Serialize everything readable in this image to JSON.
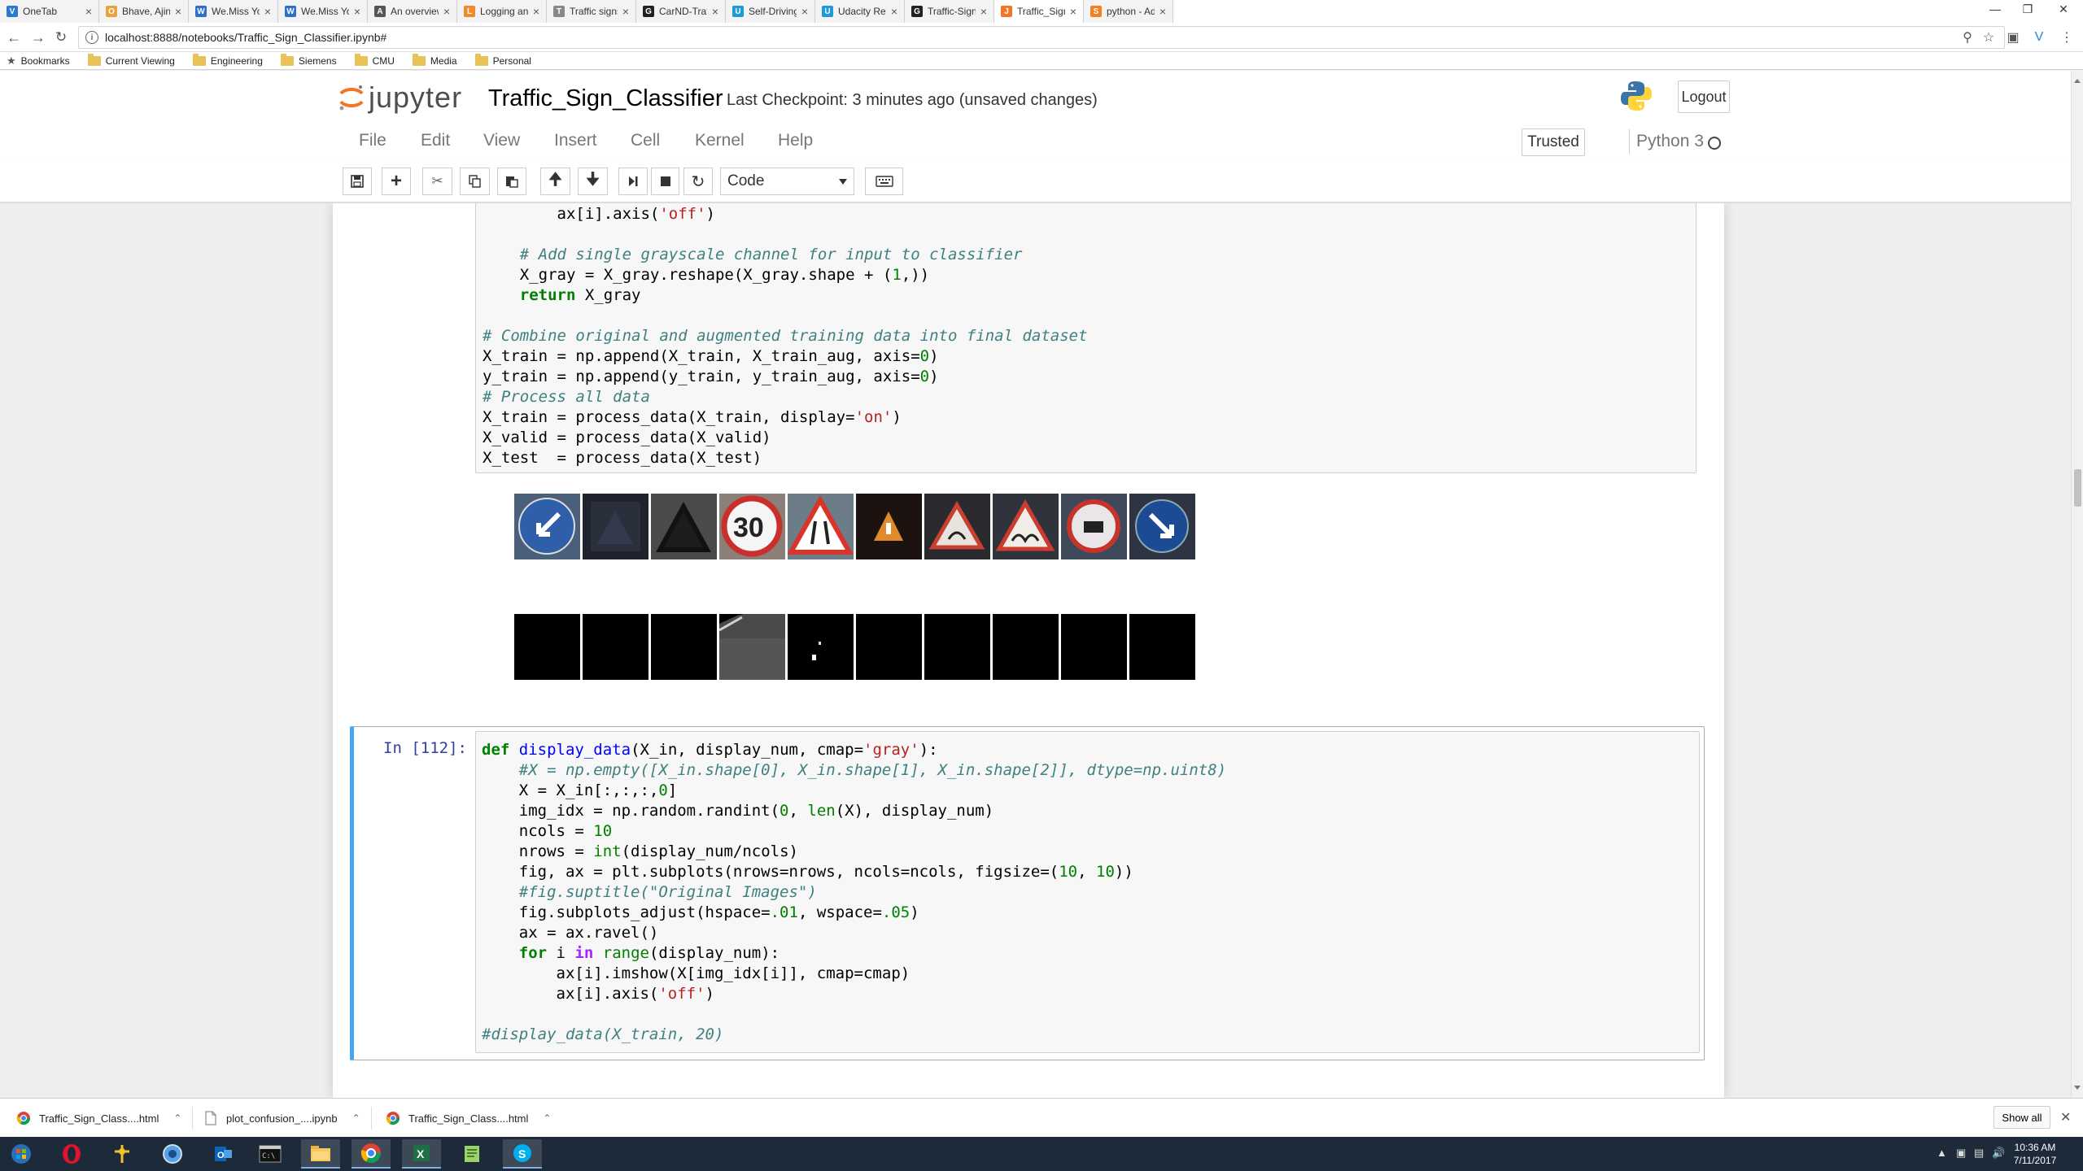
{
  "browser": {
    "tabs": [
      {
        "title": "OneTab",
        "color": "#2b79d3",
        "glyph": "V"
      },
      {
        "title": "Bhave, Ajinkya (DF PL",
        "color": "#e8a33d",
        "glyph": "O"
      },
      {
        "title": "We.Miss You?! :(",
        "color": "#2f6fc9",
        "glyph": "W"
      },
      {
        "title": "We.Miss You?! :(",
        "color": "#2f6fc9",
        "glyph": "W"
      },
      {
        "title": "An overview of gradie",
        "color": "#555555",
        "glyph": "A"
      },
      {
        "title": "Logging and Monitor",
        "color": "#f08a2b",
        "glyph": "L"
      },
      {
        "title": "Traffic signs classificat",
        "color": "#888888",
        "glyph": "T"
      },
      {
        "title": "CarND-Traffic-Sign-Cl",
        "color": "#222222",
        "glyph": "G"
      },
      {
        "title": "Self-Driving Car - Uda",
        "color": "#1e9bd7",
        "glyph": "U"
      },
      {
        "title": "Udacity Reviews",
        "color": "#1e9bd7",
        "glyph": "U"
      },
      {
        "title": "Traffic-Sign-Classifier",
        "color": "#222222",
        "glyph": "G"
      },
      {
        "title": "Traffic_Sign_Classifier",
        "color": "#f37626",
        "glyph": "J"
      },
      {
        "title": "python - Add colorbar",
        "color": "#f48024",
        "glyph": "S"
      }
    ],
    "url": "localhost:8888/notebooks/Traffic_Sign_Classifier.ipynb#",
    "bookmarks": [
      "Bookmarks",
      "Current Viewing",
      "Engineering",
      "Siemens",
      "CMU",
      "Media",
      "Personal"
    ]
  },
  "jupyter": {
    "logo_text": "jupyter",
    "notebook_name": "Traffic_Sign_Classifier",
    "checkpoint": "Last Checkpoint: 3 minutes ago (unsaved changes)",
    "logout": "Logout",
    "menu": [
      "File",
      "Edit",
      "View",
      "Insert",
      "Cell",
      "Kernel",
      "Help"
    ],
    "trusted": "Trusted",
    "kernel": "Python 3",
    "cell_type": "Code"
  },
  "cells": {
    "prev_code_lines": [
      "        ax[i].axis('off')",
      "",
      "    # Add single grayscale channel for input to classifier",
      "    X_gray = X_gray.reshape(X_gray.shape + (1,))",
      "    return X_gray",
      "",
      "# Combine original and augmented training data into final dataset",
      "X_train = np.append(X_train, X_train_aug, axis=0)",
      "y_train = np.append(y_train, y_train_aug, axis=0)",
      "# Process all data",
      "X_train = process_data(X_train, display='on')",
      "X_valid = process_data(X_valid)",
      "X_test  = process_data(X_test)"
    ],
    "current_prompt": "In [112]:",
    "current_code_lines": [
      "def display_data(X_in, display_num, cmap='gray'):",
      "    #X = np.empty([X_in.shape[0], X_in.shape[1], X_in.shape[2]], dtype=np.uint8)",
      "    X = X_in[:,:,:,0]",
      "    img_idx = np.random.randint(0, len(X), display_num)",
      "    ncols = 10",
      "    nrows = int(display_num/ncols)",
      "    fig, ax = plt.subplots(nrows=nrows, ncols=ncols, figsize=(10, 10))",
      "    #fig.suptitle(\"Original Images\")",
      "    fig.subplots_adjust(hspace=.01, wspace=.05)",
      "    ax = ax.ravel()",
      "    for i in range(display_num):",
      "        ax[i].imshow(X[img_idx[i]], cmap=cmap)",
      "        ax[i].axis('off')",
      "",
      "#display_data(X_train, 20)"
    ],
    "output_images_row1": [
      "keep-left-blue",
      "dark-sign",
      "dark-triangle",
      "speed-30",
      "road-narrows",
      "orange-triangle",
      "slippery-road",
      "bumpy-road",
      "no-vehicles",
      "keep-right-blue"
    ],
    "output_images_row2": [
      "black",
      "black",
      "black",
      "gray-edge",
      "black-speck",
      "black",
      "black",
      "black",
      "black",
      "black"
    ]
  },
  "downloads": [
    {
      "name": "Traffic_Sign_Class....html"
    },
    {
      "name": "plot_confusion_....ipynb"
    },
    {
      "name": "Traffic_Sign_Class....html"
    }
  ],
  "show_all": "Show all",
  "taskbar": {
    "time": "10:36 AM",
    "date": "7/11/2017"
  }
}
